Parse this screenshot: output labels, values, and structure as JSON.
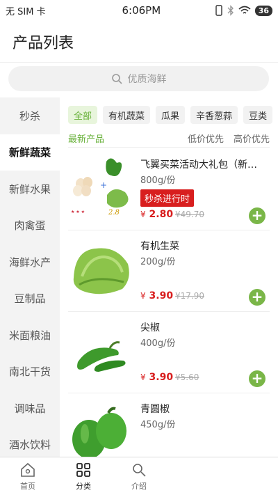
{
  "status": {
    "carrier": "无 SIM 卡",
    "time": "6:06PM",
    "battery": "36"
  },
  "header": {
    "title": "产品列表"
  },
  "search": {
    "placeholder": "优质海鲜"
  },
  "sidebar": {
    "items": [
      {
        "label": "秒杀"
      },
      {
        "label": "新鲜蔬菜"
      },
      {
        "label": "新鲜水果"
      },
      {
        "label": "肉禽蛋"
      },
      {
        "label": "海鲜水产"
      },
      {
        "label": "豆制品"
      },
      {
        "label": "米面粮油"
      },
      {
        "label": "南北干货"
      },
      {
        "label": "调味品"
      },
      {
        "label": "酒水饮料"
      }
    ],
    "active": 1
  },
  "chips": [
    "全部",
    "有机蔬菜",
    "瓜果",
    "辛香葱蒜",
    "豆类"
  ],
  "sort": {
    "newest": "最新产品",
    "low": "低价优先",
    "high": "高价优先"
  },
  "products": [
    {
      "name": "飞翼买菜活动大礼包（新…",
      "spec": "800g/份",
      "tag": "秒杀进行时",
      "currency": "¥",
      "price": "2.80",
      "old": "¥49.70"
    },
    {
      "name": "有机生菜",
      "spec": "200g/份",
      "currency": "¥",
      "price": "3.90",
      "old": "¥17.90"
    },
    {
      "name": "尖椒",
      "spec": "400g/份",
      "currency": "¥",
      "price": "3.90",
      "old": "¥5.60"
    },
    {
      "name": "青圆椒",
      "spec": "450g/份"
    }
  ],
  "tabs": [
    {
      "label": "首页",
      "icon": "home-icon"
    },
    {
      "label": "分类",
      "icon": "category-icon"
    },
    {
      "label": "介绍",
      "icon": "search-icon"
    }
  ],
  "colors": {
    "accent": "#6ab23c",
    "price": "#d81e1e",
    "add": "#7ab648"
  }
}
